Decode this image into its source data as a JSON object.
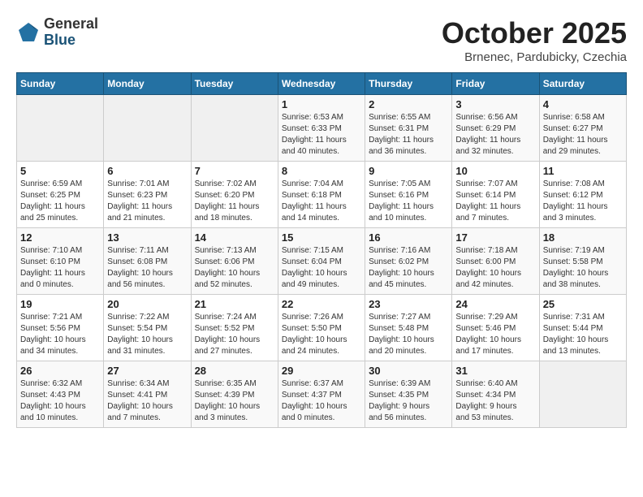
{
  "header": {
    "logo_general": "General",
    "logo_blue": "Blue",
    "month_title": "October 2025",
    "subtitle": "Brnenec, Pardubicky, Czechia"
  },
  "days_of_week": [
    "Sunday",
    "Monday",
    "Tuesday",
    "Wednesday",
    "Thursday",
    "Friday",
    "Saturday"
  ],
  "weeks": [
    [
      {
        "day": "",
        "info": ""
      },
      {
        "day": "",
        "info": ""
      },
      {
        "day": "",
        "info": ""
      },
      {
        "day": "1",
        "info": "Sunrise: 6:53 AM\nSunset: 6:33 PM\nDaylight: 11 hours\nand 40 minutes."
      },
      {
        "day": "2",
        "info": "Sunrise: 6:55 AM\nSunset: 6:31 PM\nDaylight: 11 hours\nand 36 minutes."
      },
      {
        "day": "3",
        "info": "Sunrise: 6:56 AM\nSunset: 6:29 PM\nDaylight: 11 hours\nand 32 minutes."
      },
      {
        "day": "4",
        "info": "Sunrise: 6:58 AM\nSunset: 6:27 PM\nDaylight: 11 hours\nand 29 minutes."
      }
    ],
    [
      {
        "day": "5",
        "info": "Sunrise: 6:59 AM\nSunset: 6:25 PM\nDaylight: 11 hours\nand 25 minutes."
      },
      {
        "day": "6",
        "info": "Sunrise: 7:01 AM\nSunset: 6:23 PM\nDaylight: 11 hours\nand 21 minutes."
      },
      {
        "day": "7",
        "info": "Sunrise: 7:02 AM\nSunset: 6:20 PM\nDaylight: 11 hours\nand 18 minutes."
      },
      {
        "day": "8",
        "info": "Sunrise: 7:04 AM\nSunset: 6:18 PM\nDaylight: 11 hours\nand 14 minutes."
      },
      {
        "day": "9",
        "info": "Sunrise: 7:05 AM\nSunset: 6:16 PM\nDaylight: 11 hours\nand 10 minutes."
      },
      {
        "day": "10",
        "info": "Sunrise: 7:07 AM\nSunset: 6:14 PM\nDaylight: 11 hours\nand 7 minutes."
      },
      {
        "day": "11",
        "info": "Sunrise: 7:08 AM\nSunset: 6:12 PM\nDaylight: 11 hours\nand 3 minutes."
      }
    ],
    [
      {
        "day": "12",
        "info": "Sunrise: 7:10 AM\nSunset: 6:10 PM\nDaylight: 11 hours\nand 0 minutes."
      },
      {
        "day": "13",
        "info": "Sunrise: 7:11 AM\nSunset: 6:08 PM\nDaylight: 10 hours\nand 56 minutes."
      },
      {
        "day": "14",
        "info": "Sunrise: 7:13 AM\nSunset: 6:06 PM\nDaylight: 10 hours\nand 52 minutes."
      },
      {
        "day": "15",
        "info": "Sunrise: 7:15 AM\nSunset: 6:04 PM\nDaylight: 10 hours\nand 49 minutes."
      },
      {
        "day": "16",
        "info": "Sunrise: 7:16 AM\nSunset: 6:02 PM\nDaylight: 10 hours\nand 45 minutes."
      },
      {
        "day": "17",
        "info": "Sunrise: 7:18 AM\nSunset: 6:00 PM\nDaylight: 10 hours\nand 42 minutes."
      },
      {
        "day": "18",
        "info": "Sunrise: 7:19 AM\nSunset: 5:58 PM\nDaylight: 10 hours\nand 38 minutes."
      }
    ],
    [
      {
        "day": "19",
        "info": "Sunrise: 7:21 AM\nSunset: 5:56 PM\nDaylight: 10 hours\nand 34 minutes."
      },
      {
        "day": "20",
        "info": "Sunrise: 7:22 AM\nSunset: 5:54 PM\nDaylight: 10 hours\nand 31 minutes."
      },
      {
        "day": "21",
        "info": "Sunrise: 7:24 AM\nSunset: 5:52 PM\nDaylight: 10 hours\nand 27 minutes."
      },
      {
        "day": "22",
        "info": "Sunrise: 7:26 AM\nSunset: 5:50 PM\nDaylight: 10 hours\nand 24 minutes."
      },
      {
        "day": "23",
        "info": "Sunrise: 7:27 AM\nSunset: 5:48 PM\nDaylight: 10 hours\nand 20 minutes."
      },
      {
        "day": "24",
        "info": "Sunrise: 7:29 AM\nSunset: 5:46 PM\nDaylight: 10 hours\nand 17 minutes."
      },
      {
        "day": "25",
        "info": "Sunrise: 7:31 AM\nSunset: 5:44 PM\nDaylight: 10 hours\nand 13 minutes."
      }
    ],
    [
      {
        "day": "26",
        "info": "Sunrise: 6:32 AM\nSunset: 4:43 PM\nDaylight: 10 hours\nand 10 minutes."
      },
      {
        "day": "27",
        "info": "Sunrise: 6:34 AM\nSunset: 4:41 PM\nDaylight: 10 hours\nand 7 minutes."
      },
      {
        "day": "28",
        "info": "Sunrise: 6:35 AM\nSunset: 4:39 PM\nDaylight: 10 hours\nand 3 minutes."
      },
      {
        "day": "29",
        "info": "Sunrise: 6:37 AM\nSunset: 4:37 PM\nDaylight: 10 hours\nand 0 minutes."
      },
      {
        "day": "30",
        "info": "Sunrise: 6:39 AM\nSunset: 4:35 PM\nDaylight: 9 hours\nand 56 minutes."
      },
      {
        "day": "31",
        "info": "Sunrise: 6:40 AM\nSunset: 4:34 PM\nDaylight: 9 hours\nand 53 minutes."
      },
      {
        "day": "",
        "info": ""
      }
    ]
  ]
}
